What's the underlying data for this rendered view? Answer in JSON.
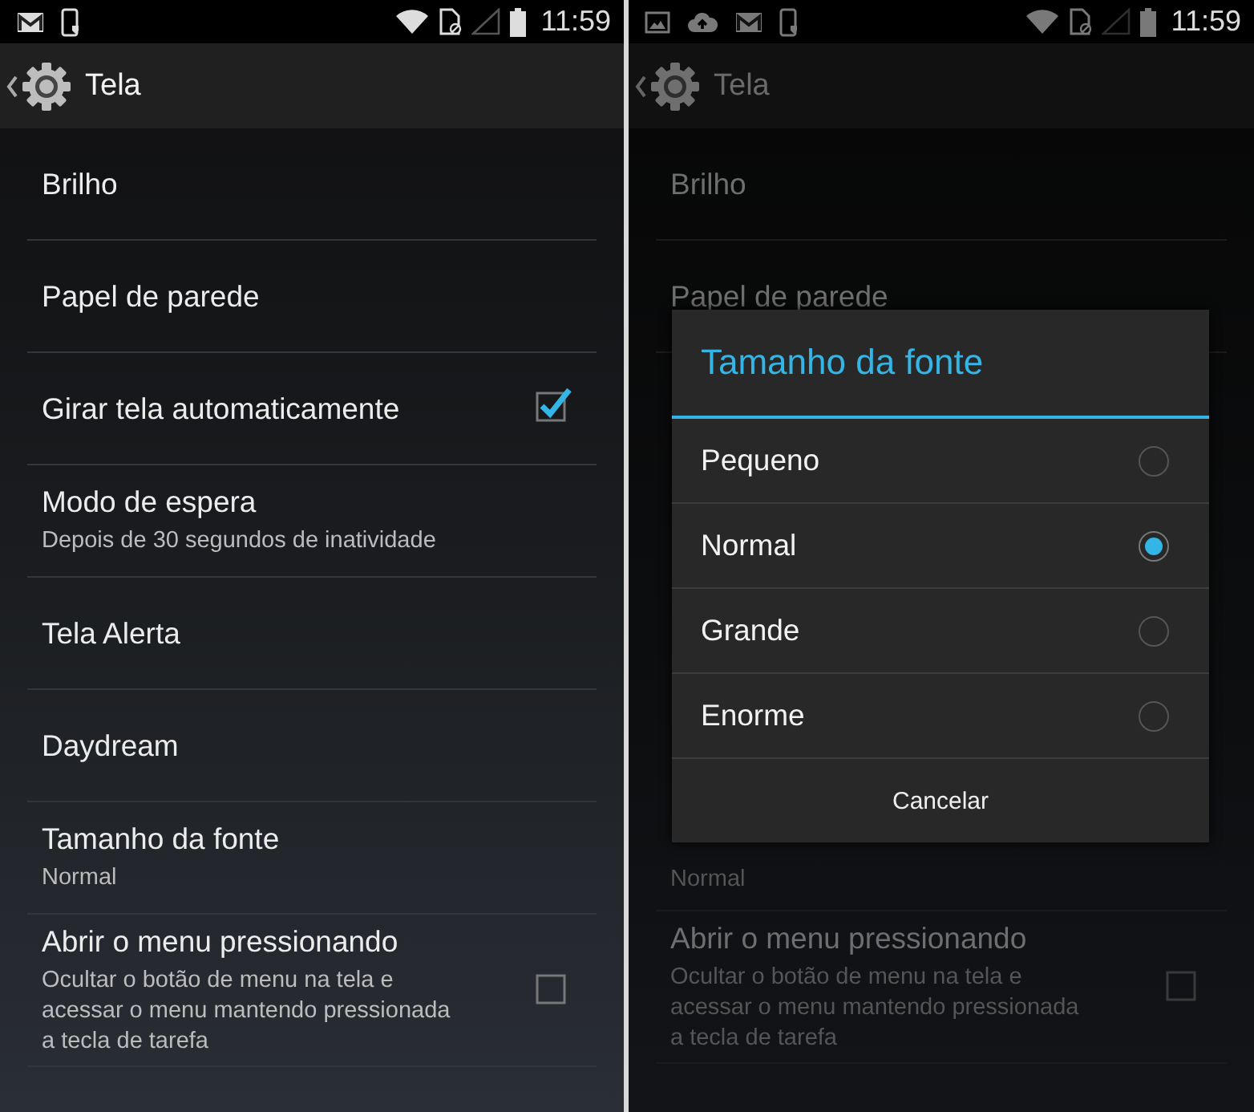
{
  "screens": [
    {
      "dimmed": false,
      "status_bar": {
        "time": "11:59"
      },
      "action_bar": {
        "title": "Tela"
      },
      "items": [
        {
          "kind": "plain",
          "title": "Brilho"
        },
        {
          "kind": "plain",
          "title": "Papel de parede"
        },
        {
          "kind": "checkbox",
          "title": "Girar tela automaticamente",
          "checked": true
        },
        {
          "kind": "plain",
          "title": "Modo de espera",
          "summary": "Depois de 30 segundos de inatividade"
        },
        {
          "kind": "plain",
          "title": "Tela Alerta"
        },
        {
          "kind": "plain",
          "title": "Daydream"
        },
        {
          "kind": "plain",
          "title": "Tamanho da fonte",
          "summary": "Normal"
        },
        {
          "kind": "checkbox",
          "title": "Abrir o menu pressionando",
          "summary": "Ocultar o botão de menu na tela e acessar o menu mantendo pressionada a tecla de tarefa",
          "checked": false
        }
      ]
    },
    {
      "dimmed": true,
      "status_bar": {
        "time": "11:59"
      },
      "action_bar": {
        "title": "Tela"
      },
      "items": [
        {
          "kind": "plain",
          "title": "Brilho"
        },
        {
          "kind": "plain",
          "title": "Papel de parede"
        }
      ],
      "dialog": {
        "title": "Tamanho da fonte",
        "options": [
          {
            "label": "Pequeno",
            "selected": false
          },
          {
            "label": "Normal",
            "selected": true
          },
          {
            "label": "Grande",
            "selected": false
          },
          {
            "label": "Enorme",
            "selected": false
          }
        ],
        "button": "Cancelar"
      },
      "items_below": [
        {
          "kind": "plain",
          "summary": "Normal"
        },
        {
          "kind": "checkbox",
          "title": "Abrir o menu pressionando",
          "summary": "Ocultar o botão de menu na tela e acessar o menu mantendo pressionada a tecla de tarefa",
          "checked": false
        }
      ]
    }
  ]
}
